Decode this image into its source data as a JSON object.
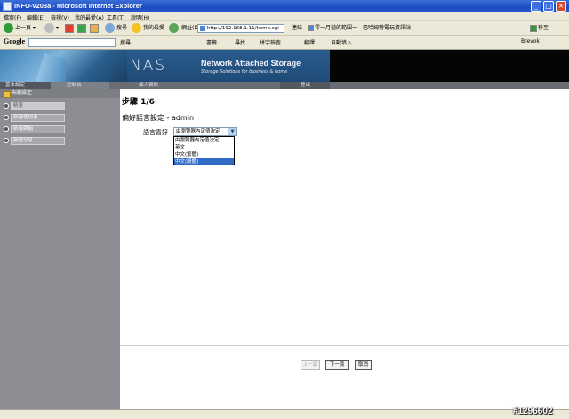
{
  "window": {
    "title": "INFO-v203a - Microsoft Internet Explorer"
  },
  "menu": [
    "檔案(F)",
    "編輯(E)",
    "檢視(V)",
    "我的最愛(A)",
    "工具(T)",
    "說明(H)"
  ],
  "toolbar": {
    "back": "上一頁",
    "search": "搜尋",
    "favorites": "我的最愛",
    "address_label": "網址(D)",
    "address": "http://192.168.1.11/home.cgi",
    "link_label": "連結",
    "link_text": "零一月拋的範圍一 - 巴哈姆特電玩資訊站",
    "go": "移至"
  },
  "google_bar": {
    "logo": "Google",
    "search": "搜尋",
    "bookmarks": "書籤",
    "find": "尋找",
    "spell": "拼字檢查",
    "translate": "翻譯",
    "autofill": "自動填入",
    "user": "Brevok"
  },
  "banner": {
    "logo": "NAS",
    "title": "Network Attached Storage",
    "subtitle": "Storage Solutions for business & home"
  },
  "nav": [
    "基本設定",
    "控制台",
    "個人資訊",
    "登出"
  ],
  "sidebar": {
    "header": "快速設定",
    "items": [
      "精靈",
      "新增使用者",
      "新增群組",
      "新增分享"
    ]
  },
  "main": {
    "step": "步驟 1/6",
    "subtitle": "偏好語言設定 - admin",
    "language_label": "語言喜好",
    "selected": "由瀏覽器內定值決定",
    "options": [
      "由瀏覽器內定值決定",
      "英文",
      "中文(繁體)",
      "中文(簡體)"
    ],
    "highlighted_index": 3,
    "buttons": {
      "prev": "上一頁",
      "next": "下一頁",
      "cancel": "取消"
    }
  },
  "watermark": "#1296602"
}
